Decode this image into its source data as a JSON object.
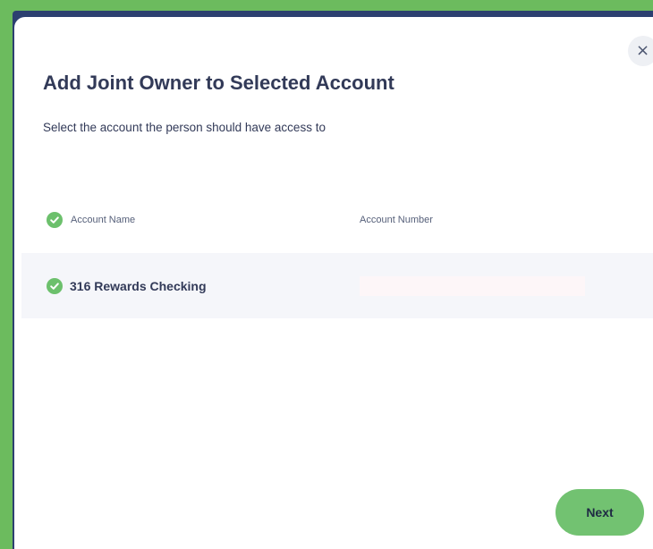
{
  "dialog": {
    "title": "Add Joint Owner to Selected Account",
    "subtitle": "Select the account the person should have access to",
    "close_symbol": "×"
  },
  "table": {
    "columns": [
      "Account Name",
      "Account Number"
    ],
    "rows": [
      {
        "account_name": "316 Rewards Checking",
        "account_number": "",
        "selected": true
      }
    ]
  },
  "footer": {
    "next_label": "Next"
  },
  "icons": {
    "check": "check-circle-icon",
    "close": "close-icon"
  },
  "colors": {
    "frame_green": "#6cbb5e",
    "backdrop_navy": "#2c3f70",
    "check_green": "#6cc06c",
    "button_green": "#72c271",
    "text_dark": "#323a58",
    "row_background": "#f5f6fa"
  }
}
